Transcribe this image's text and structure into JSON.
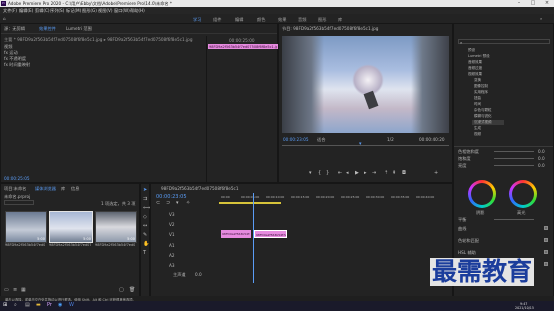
{
  "title_bar": {
    "title": "Adobe Premiere Pro 2020 - C:\\用户\\Ebby\\文档\\Adobe\\Premiere Pro\\14.0\\未命名 *"
  },
  "menu": [
    "文件(F)",
    "编辑(E)",
    "剪辑(C)",
    "序列(S)",
    "标记(M)",
    "图形(G)",
    "视图(V)",
    "窗口(W)",
    "帮助(H)"
  ],
  "workspaces": {
    "items": [
      "学习",
      "组件",
      "编辑",
      "颜色",
      "效果",
      "音频",
      "图形",
      "库"
    ],
    "active_index": 0
  },
  "source_panel": {
    "tabs": [
      "源：无剪辑",
      "效果控件",
      "Lumetri 范围"
    ],
    "path": "主要 * 98FD9a2f563b54f7ed07508f6f8e5c1.jpg ▸ 98FD9a2f563b54f7ed07508f6f8e5c1.jpg",
    "rows": [
      "视频",
      "fx 运动",
      "fx 不透明度",
      "fx 时间重映射"
    ],
    "timecode": "00:00:25:05",
    "mini_timecode": "00:00:25:00",
    "clip_label": "98FD9a2f563b54f7ed07508f6f8e5c1.jpg"
  },
  "program_monitor": {
    "title": "节目: 98FD9a2f563b54f7ed07508f6f8e5c1.jpg",
    "timecode": "00:00:23:05",
    "fit": "适合",
    "ratio": "1/2",
    "duration": "00:00:40:20"
  },
  "project_panel": {
    "tabs": [
      "项目:未命名",
      "媒体浏览器",
      "库",
      "信息"
    ],
    "project_file": "未命名.prproj",
    "search_placeholder": "",
    "count": "1 项选定，共 3 项",
    "items": [
      {
        "name": "98FD9a2f563b54f7ed07508f6f8e5c1...",
        "duration": "5:00"
      },
      {
        "name": "98FD9a2f563b54f7ed07...",
        "duration": "5:00"
      },
      {
        "name": "98FD9a2f563b54f7ed0750...",
        "duration": "5:00"
      }
    ]
  },
  "timeline": {
    "tab": "98FD9a2f563b54f7ed07508f6f8e5c1",
    "timecode": "00:00:23:05",
    "ruler": [
      "00:00",
      "00:00:05:00",
      "00:00:10:00",
      "00:00:15:00",
      "00:00:20:00",
      "00:00:25:00",
      "00:00:30:00",
      "00:00:35:00",
      "00:00:40:00"
    ],
    "tracks_video": [
      "V3",
      "V2",
      "V1"
    ],
    "tracks_audio": [
      "A1",
      "A2",
      "A3"
    ],
    "master": "主声道",
    "master_value": "0.0",
    "clips": [
      "98FD9a2f563b54f7ed0750",
      "98FD9a2f563b54f7ed0750"
    ],
    "playhead_fraction": 0.22
  },
  "effects_panel": {
    "search_placeholder": "",
    "tree": [
      "预设",
      "Lumetri 预设",
      "音频效果",
      "音频过渡",
      "视频效果",
      "变换",
      "图像控制",
      "实用程序",
      "扭曲",
      "时间",
      "杂色与颗粒",
      "模糊与锐化",
      "沉浸式视频",
      "生成",
      "视频",
      "调整",
      "过时",
      "过渡",
      "透视",
      "通道",
      "键控",
      "颜色校正",
      "风格化",
      "视频过渡"
    ],
    "selected": "沉浸式视频"
  },
  "lumetri": {
    "wheel_labels": [
      "阴影",
      "中间调",
      "高光"
    ],
    "rows": [
      "色相饱和度",
      "饱和度",
      "亮度",
      "高光",
      "阴影",
      "中间调",
      "平衡"
    ],
    "values": [
      "0.0",
      "0.0",
      "0.0",
      "0.0",
      "0.0",
      "0.0"
    ],
    "checkbox_labels": [
      "曲线",
      "色轮和匹配",
      "HSL 辅助",
      "晕影"
    ],
    "watermark": "最需教育"
  },
  "taskbar": {
    "time": "9:47",
    "date": "2021/10/15"
  },
  "status_bar": {
    "text": "单击以选择，或单击空白处并拖动以进行框选。使用 Shift、Alt 和 Ctrl 可获得其他选项。"
  }
}
